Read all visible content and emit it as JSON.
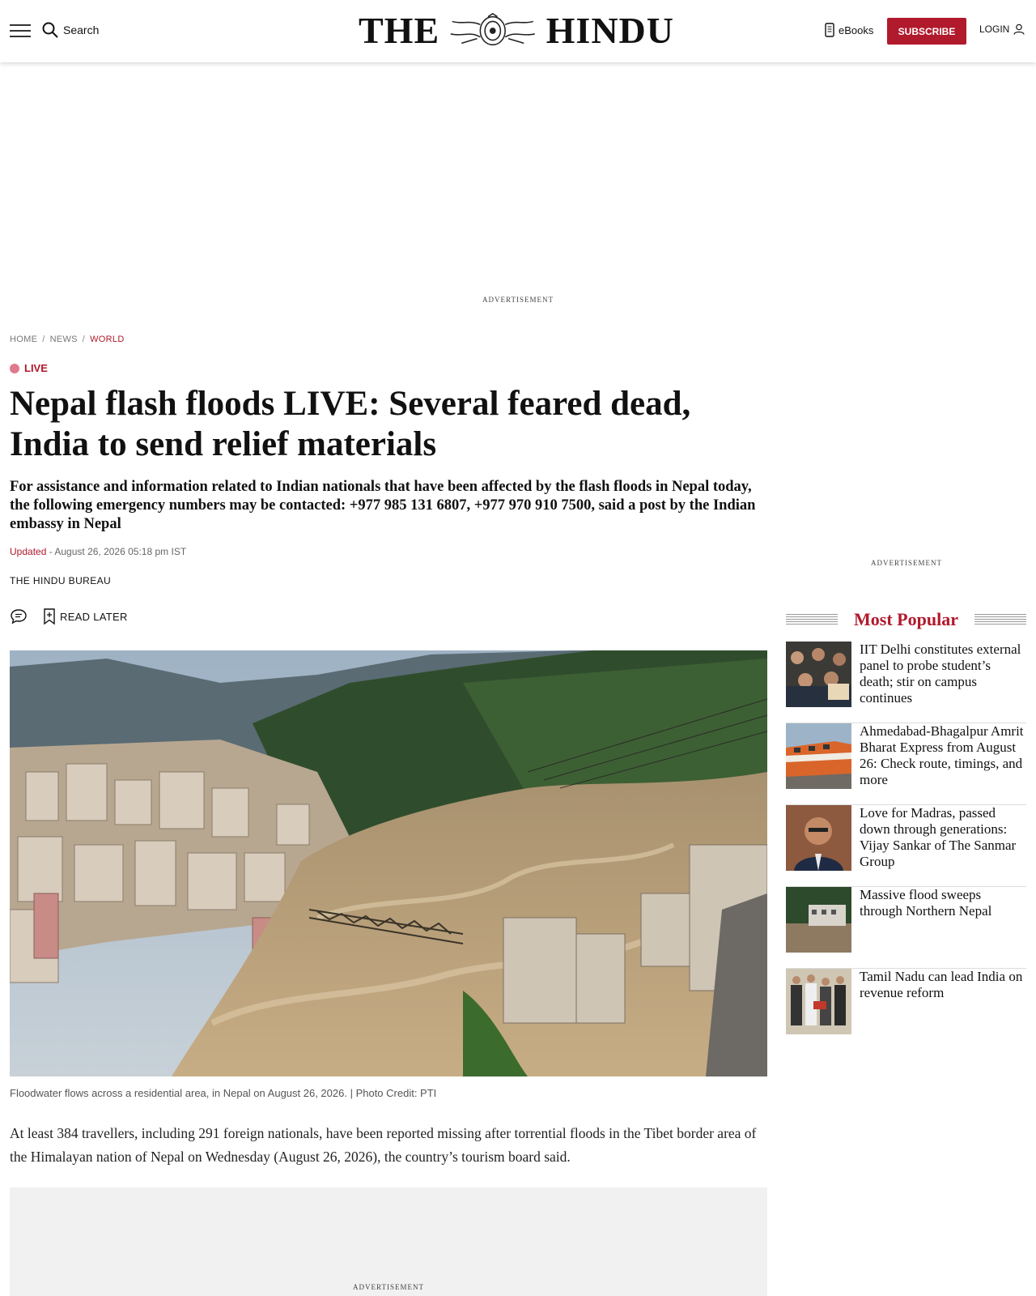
{
  "header": {
    "search_label": "Search",
    "logo_left": "THE",
    "logo_right": "HINDU",
    "ebooks_label": "eBooks",
    "subscribe_label": "SUBSCRIBE",
    "login_label": "LOGIN"
  },
  "ads": {
    "label": "ADVERTISEMENT"
  },
  "breadcrumb": {
    "items": [
      "HOME",
      "NEWS",
      "WORLD"
    ],
    "separator": "/"
  },
  "article": {
    "live_label": "LIVE",
    "headline": "Nepal flash floods LIVE: Several feared dead, India to send relief materials",
    "subhead": "For assistance and information related to Indian nationals that have been affected by the flash floods in Nepal today, the following emergency numbers may be contacted: +977 985 131 6807, +977 970 910 7500, said a post by the Indian embassy in Nepal",
    "updated_label": "Updated",
    "updated_time": " - August 26, 2026 05:18 pm IST",
    "byline": "THE HINDU BUREAU",
    "read_later_label": "READ LATER",
    "image_caption": "Floodwater flows across a residential area, in Nepal on August 26, 2026. | Photo Credit: PTI",
    "body": "At least 384 travellers, including 291 foreign nationals, have been reported missing after torrential floods in the Tibet border area of the Himalayan nation of Nepal on Wednesday (August 26, 2026), the country’s tourism board said."
  },
  "sidebar": {
    "most_popular_title": "Most Popular",
    "items": [
      {
        "title": "IIT Delhi constitutes external panel to probe student’s death; stir on campus continues"
      },
      {
        "title": "Ahmedabad-Bhagalpur Amrit Bharat Express from August 26: Check route, timings, and more"
      },
      {
        "title": "Love for Madras, passed down through generations: Vijay Sankar of The Sanmar Group"
      },
      {
        "title": "Massive flood sweeps through Northern Nepal"
      },
      {
        "title": "Tamil Nadu can lead India on revenue reform"
      }
    ]
  },
  "colors": {
    "brand_red": "#b1192c",
    "live_dot": "#e07a8a"
  }
}
